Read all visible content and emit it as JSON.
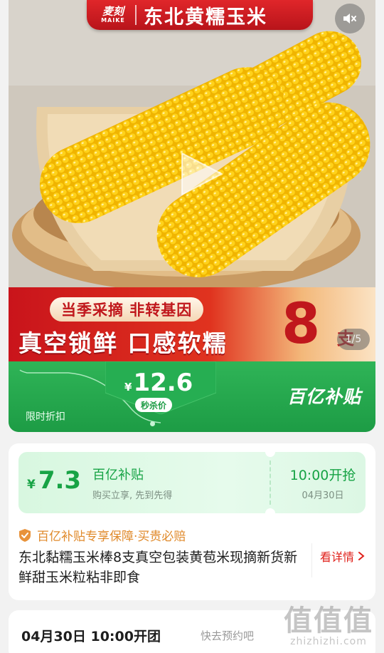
{
  "hero": {
    "brand_logo_cn": "麦刻",
    "brand_logo_en": "MAIKE",
    "brand_title": "东北黄糯玉米",
    "mute_icon": "speaker-muted-icon",
    "play_icon": "play-icon"
  },
  "promo": {
    "pill": "当季采摘 非转基因",
    "headline": "真空锁鲜 口感软糯",
    "count_number": "8",
    "count_unit": "支",
    "page_indicator": "1/5"
  },
  "price_band": {
    "label": "限时折扣",
    "currency": "¥",
    "price": "12.6",
    "badge": "秒杀价",
    "program_logo": "百亿补贴"
  },
  "coupon": {
    "currency": "¥",
    "price": "7.3",
    "title": "百亿补贴",
    "subtitle": "购买立享, 先到先得",
    "time": "10:00开抢",
    "date": "04月30日"
  },
  "info": {
    "guarantee": "百亿补贴专享保障·买贵必赔",
    "product_title": "东北黏糯玉米棒8支真空包装黄苞米现摘新货新鲜甜玉米粒粘非即食",
    "detail_link": "看详情"
  },
  "bottom": {
    "schedule": "04月30日 10:00开团",
    "hint": "快去预约吧"
  },
  "watermark": {
    "cn": "值值值",
    "en": "zhizhizhi.com"
  },
  "colors": {
    "brand_red": "#c0171c",
    "subsidy_green": "#1d9c45",
    "coupon_green": "#17a345",
    "guarantee_orange": "#e08a2b",
    "link_red": "#e0211b"
  }
}
